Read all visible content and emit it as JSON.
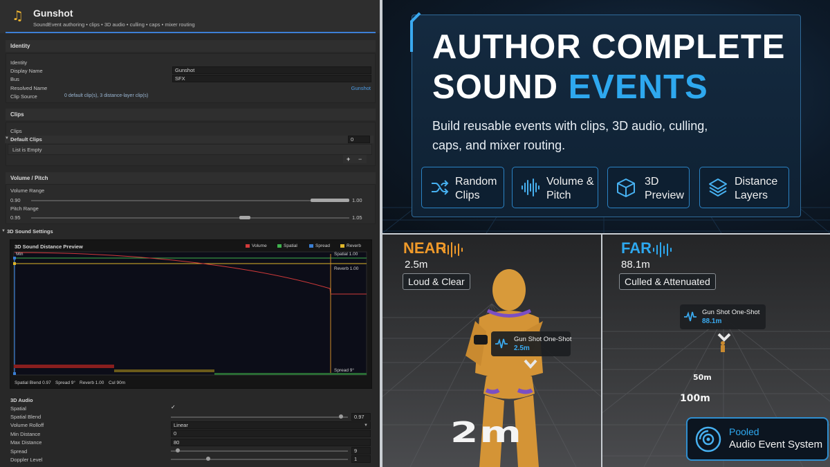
{
  "inspector": {
    "title": "Gunshot",
    "subtitle": "SoundEvent authoring • clips • 3D audio • culling • caps • mixer routing",
    "identity": {
      "section": "Identity",
      "group": "Identity",
      "display_name_label": "Display Name",
      "display_name_value": "Gunshot",
      "bus_label": "Bus",
      "bus_value": "SFX",
      "resolved_name_label": "Resolved Name",
      "resolved_name_value": "Gunshot",
      "clip_source_label": "Clip Source",
      "clip_source_value": "0 default clip(s), 3 distance-layer clip(s)"
    },
    "clips": {
      "section": "Clips",
      "group": "Clips",
      "default_clips_label": "Default Clips",
      "default_clips_count": "0",
      "list_empty": "List is Empty",
      "add": "+",
      "remove": "−"
    },
    "volume_pitch": {
      "section": "Volume / Pitch",
      "volume_range_label": "Volume Range",
      "volume_min": "0.90",
      "volume_max": "1.00",
      "pitch_range_label": "Pitch Range",
      "pitch_min": "0.95",
      "pitch_max": "1.05"
    },
    "sound3d": {
      "section": "3D Sound Settings",
      "graph_title": "3D Sound Distance Preview",
      "legend": [
        "Volume",
        "Spatial",
        "Spread",
        "Reverb"
      ],
      "min_label": "Min",
      "spatial_marker": "Spatial 1.00",
      "reverb_marker": "Reverb 1.00",
      "spread_marker": "Spread 9°",
      "footer": [
        "Spatial Blend 0.97",
        "Spread 9°",
        "Reverb 1.00",
        "Cul 90m"
      ],
      "group": "3D Audio",
      "spatial_label": "Spatial",
      "spatial_check": "✓",
      "spatial_blend_label": "Spatial Blend",
      "spatial_blend_value": "0.97",
      "volume_rolloff_label": "Volume Rolloff",
      "volume_rolloff_value": "Linear",
      "min_distance_label": "Min Distance",
      "min_distance_value": "0",
      "max_distance_label": "Max Distance",
      "max_distance_value": "80",
      "spread_label": "Spread",
      "spread_value": "9",
      "doppler_label": "Doppler Level",
      "doppler_value": "1"
    },
    "colors": {
      "volume": "#d23a3a",
      "spatial": "#3fb24d",
      "spread": "#3a7fd4",
      "reverb": "#e0b62a"
    }
  },
  "hero": {
    "line1": "AUTHOR COMPLETE",
    "line2_a": "SOUND",
    "line2_b": "EVENTS",
    "body": "Build reusable events with clips, 3D audio, culling, caps, and mixer routing.",
    "features": [
      {
        "icon": "shuffle-icon",
        "l1": "Random",
        "l2": "Clips"
      },
      {
        "icon": "waveform-icon",
        "l1": "Volume &",
        "l2": "Pitch"
      },
      {
        "icon": "cube-icon",
        "l1": "3D",
        "l2": "Preview"
      },
      {
        "icon": "layers-icon",
        "l1": "Distance",
        "l2": "Layers"
      }
    ],
    "accent": "#2ea8ef"
  },
  "near": {
    "word": "NEAR",
    "distance": "2.5m",
    "tag": "Loud & Clear",
    "bubble_title": "Gun Shot One-Shot",
    "bubble_dist": "2.5m",
    "floor": "2m"
  },
  "far": {
    "word": "FAR",
    "distance": "88.1m",
    "tag": "Culled & Attenuated",
    "bubble_title": "Gun Shot One-Shot",
    "bubble_dist": "88.1m",
    "floor_50": "50m",
    "floor_100": "100m"
  },
  "pooled": {
    "line1": "Pooled",
    "line2": "Audio Event System"
  }
}
